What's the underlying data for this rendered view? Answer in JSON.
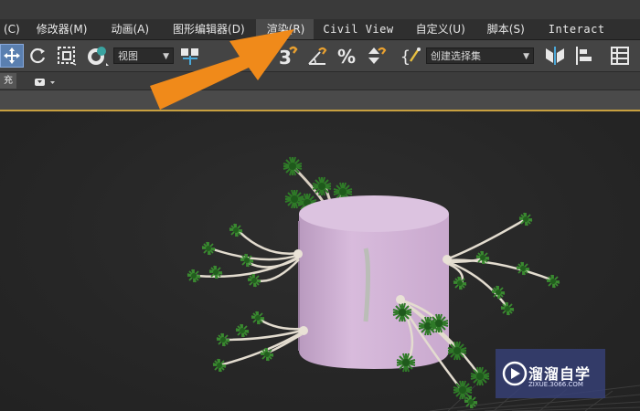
{
  "menubar": {
    "items": [
      {
        "label": "(C)"
      },
      {
        "label": "修改器(M)"
      },
      {
        "label": "动画(A)"
      },
      {
        "label": "图形编辑器(D)"
      },
      {
        "label": "渲染(R)"
      },
      {
        "label": "Civil View"
      },
      {
        "label": "自定义(U)"
      },
      {
        "label": "脚本(S)"
      },
      {
        "label": "Interact"
      }
    ],
    "active_index": 4
  },
  "toolbar": {
    "view_dropdown": "视图",
    "selection_set_dropdown": "创建选择集"
  },
  "ribbon": {
    "tab_label": "充"
  },
  "watermark": {
    "title": "溜溜自学",
    "url": "ZIXUE.3066.COM"
  },
  "colors": {
    "arrow": "#f08a1a",
    "cylinder": "#d3b3d8",
    "accent_line": "#c8a040",
    "viewport_bg": "#262626"
  }
}
